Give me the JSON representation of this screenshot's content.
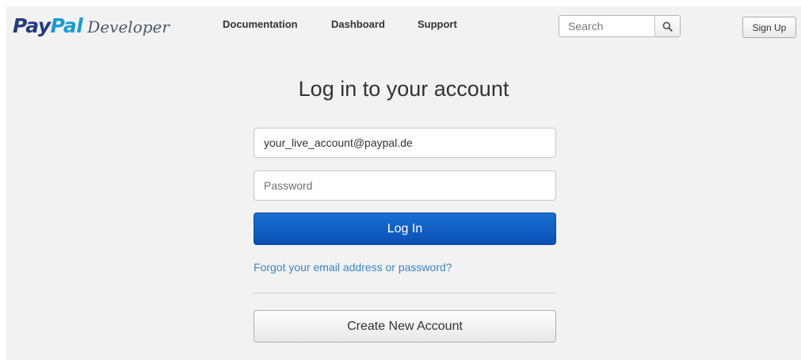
{
  "header": {
    "logo": {
      "pay": "Pay",
      "pal": "Pal",
      "developer": "Developer"
    },
    "nav": [
      {
        "label": "Documentation"
      },
      {
        "label": "Dashboard"
      },
      {
        "label": "Support"
      }
    ],
    "search": {
      "placeholder": "Search",
      "icon": "search-icon"
    },
    "sign_up_label": "Sign Up"
  },
  "login": {
    "title": "Log in to your account",
    "email_value": "your_live_account@paypal.de",
    "password_placeholder": "Password",
    "login_label": "Log In",
    "forgot_link": "Forgot your email address or password?",
    "create_account_label": "Create New Account"
  },
  "colors": {
    "brand_dark": "#253b80",
    "brand_light": "#179bd7",
    "login_button": "#0a5ec4",
    "link": "#3c86c9",
    "background": "#f2f2f2"
  }
}
